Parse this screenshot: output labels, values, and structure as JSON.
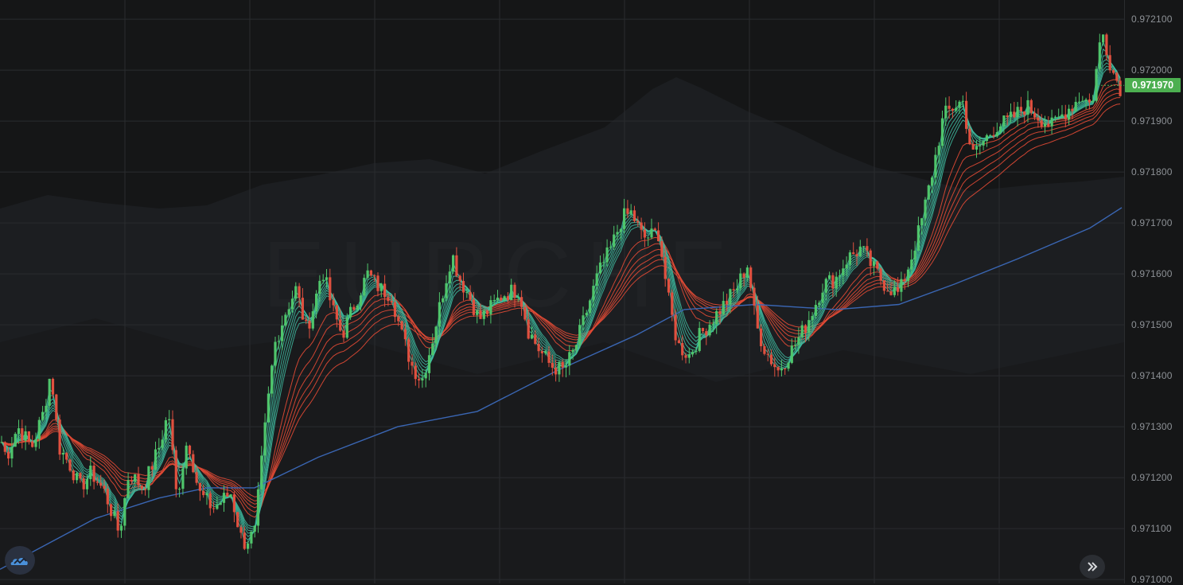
{
  "colors": {
    "background": "#151617",
    "grid": "#2a2c2f",
    "candle_up": "#4fc56b",
    "candle_down": "#e0503f",
    "fast_ma": "#3fbfa3",
    "slow_ma": "#e34a35",
    "long_ma": "#3a66b3",
    "last_price_tag": "#4caf50",
    "axis_text": "#8d9196"
  },
  "icons": {
    "logo": "tradingview-cloud-icon",
    "scroll": "double-chevron-right-icon"
  },
  "last_price": "0.971970",
  "chart_data": {
    "type": "candlestick",
    "title": "",
    "watermark": "EURCHF",
    "y_axis_ticks": [
      "0.972100",
      "0.972000",
      "0.971900",
      "0.971800",
      "0.971700",
      "0.971600",
      "0.971500",
      "0.971400",
      "0.971300",
      "0.971200",
      "0.971100",
      "0.971000"
    ],
    "ylim": [
      0.971,
      0.97214
    ],
    "grid": true,
    "price_path": [
      [
        0,
        0.97128
      ],
      [
        8,
        0.97124
      ],
      [
        22,
        0.9713
      ],
      [
        40,
        0.97126
      ],
      [
        55,
        0.97133
      ],
      [
        64,
        0.97141
      ],
      [
        74,
        0.97126
      ],
      [
        90,
        0.97122
      ],
      [
        100,
        0.97118
      ],
      [
        115,
        0.97121
      ],
      [
        132,
        0.97117
      ],
      [
        150,
        0.97109
      ],
      [
        162,
        0.97121
      ],
      [
        180,
        0.97118
      ],
      [
        200,
        0.97126
      ],
      [
        212,
        0.97133
      ],
      [
        222,
        0.97116
      ],
      [
        236,
        0.97128
      ],
      [
        250,
        0.97117
      ],
      [
        268,
        0.97114
      ],
      [
        290,
        0.97117
      ],
      [
        305,
        0.97107
      ],
      [
        320,
        0.97109
      ],
      [
        334,
        0.97131
      ],
      [
        345,
        0.97146
      ],
      [
        360,
        0.97153
      ],
      [
        372,
        0.97157
      ],
      [
        385,
        0.97149
      ],
      [
        395,
        0.97154
      ],
      [
        405,
        0.97161
      ],
      [
        418,
        0.97153
      ],
      [
        430,
        0.97148
      ],
      [
        448,
        0.97155
      ],
      [
        462,
        0.9716
      ],
      [
        478,
        0.97157
      ],
      [
        492,
        0.97156
      ],
      [
        505,
        0.97148
      ],
      [
        518,
        0.97142
      ],
      [
        530,
        0.97139
      ],
      [
        542,
        0.97146
      ],
      [
        556,
        0.97156
      ],
      [
        568,
        0.97164
      ],
      [
        578,
        0.97159
      ],
      [
        592,
        0.97155
      ],
      [
        602,
        0.97151
      ],
      [
        615,
        0.97153
      ],
      [
        632,
        0.97156
      ],
      [
        652,
        0.97157
      ],
      [
        664,
        0.97149
      ],
      [
        678,
        0.97145
      ],
      [
        692,
        0.97142
      ],
      [
        708,
        0.97141
      ],
      [
        722,
        0.97145
      ],
      [
        738,
        0.97153
      ],
      [
        752,
        0.9716
      ],
      [
        768,
        0.97165
      ],
      [
        782,
        0.97171
      ],
      [
        794,
        0.97172
      ],
      [
        808,
        0.97167
      ],
      [
        828,
        0.97168
      ],
      [
        840,
        0.97155
      ],
      [
        852,
        0.97146
      ],
      [
        866,
        0.97144
      ],
      [
        880,
        0.97148
      ],
      [
        895,
        0.97151
      ],
      [
        910,
        0.97154
      ],
      [
        925,
        0.97157
      ],
      [
        940,
        0.97162
      ],
      [
        950,
        0.9715
      ],
      [
        962,
        0.97145
      ],
      [
        978,
        0.97141
      ],
      [
        995,
        0.97145
      ],
      [
        1010,
        0.97149
      ],
      [
        1022,
        0.97153
      ],
      [
        1035,
        0.97158
      ],
      [
        1050,
        0.97159
      ],
      [
        1065,
        0.97163
      ],
      [
        1082,
        0.97165
      ],
      [
        1098,
        0.97161
      ],
      [
        1112,
        0.97158
      ],
      [
        1130,
        0.97156
      ],
      [
        1145,
        0.97163
      ],
      [
        1158,
        0.9717
      ],
      [
        1172,
        0.9718
      ],
      [
        1186,
        0.97191
      ],
      [
        1200,
        0.97193
      ],
      [
        1210,
        0.97194
      ],
      [
        1222,
        0.97183
      ],
      [
        1236,
        0.97186
      ],
      [
        1252,
        0.97189
      ],
      [
        1268,
        0.9719
      ],
      [
        1290,
        0.97193
      ],
      [
        1305,
        0.97191
      ],
      [
        1322,
        0.97189
      ],
      [
        1340,
        0.97192
      ],
      [
        1360,
        0.97195
      ],
      [
        1372,
        0.97193
      ],
      [
        1385,
        0.97208
      ],
      [
        1398,
        0.972
      ],
      [
        1410,
        0.97196
      ]
    ],
    "long_ma_path": [
      [
        0,
        0.97102
      ],
      [
        60,
        0.97107
      ],
      [
        120,
        0.97112
      ],
      [
        200,
        0.97116
      ],
      [
        260,
        0.97118
      ],
      [
        320,
        0.97118
      ],
      [
        400,
        0.97124
      ],
      [
        500,
        0.9713
      ],
      [
        600,
        0.97133
      ],
      [
        700,
        0.97141
      ],
      [
        800,
        0.97148
      ],
      [
        860,
        0.97153
      ],
      [
        950,
        0.97154
      ],
      [
        1050,
        0.97153
      ],
      [
        1130,
        0.97154
      ],
      [
        1200,
        0.97158
      ],
      [
        1280,
        0.97163
      ],
      [
        1370,
        0.97169
      ],
      [
        1410,
        0.97173
      ]
    ]
  }
}
